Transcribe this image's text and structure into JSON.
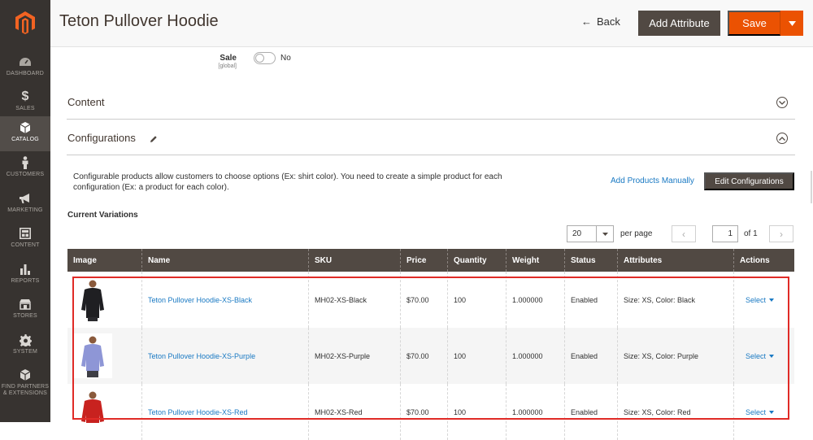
{
  "sidebar": {
    "items": [
      {
        "label": "DASHBOARD",
        "icon": "dashboard-icon"
      },
      {
        "label": "SALES",
        "icon": "dollar-icon"
      },
      {
        "label": "CATALOG",
        "icon": "cube-icon",
        "active": true
      },
      {
        "label": "CUSTOMERS",
        "icon": "person-icon"
      },
      {
        "label": "MARKETING",
        "icon": "megaphone-icon"
      },
      {
        "label": "CONTENT",
        "icon": "content-icon"
      },
      {
        "label": "REPORTS",
        "icon": "bar-chart-icon"
      },
      {
        "label": "STORES",
        "icon": "store-icon"
      },
      {
        "label": "SYSTEM",
        "icon": "gear-icon"
      },
      {
        "label": "FIND PARTNERS & EXTENSIONS",
        "icon": "partners-icon"
      }
    ]
  },
  "header": {
    "title": "Teton Pullover Hoodie",
    "back_label": "Back",
    "add_attribute_label": "Add Attribute",
    "save_label": "Save"
  },
  "sale_field": {
    "label": "Sale",
    "scope": "[global]",
    "value": "No"
  },
  "sections": {
    "content_title": "Content",
    "configurations_title": "Configurations"
  },
  "configurations": {
    "description": "Configurable products allow customers to choose options (Ex: shirt color). You need to create a simple product for each configuration (Ex: a product for each color).",
    "add_manually_label": "Add Products Manually",
    "edit_label": "Edit Configurations",
    "current_variations_label": "Current Variations"
  },
  "pager": {
    "per_page_value": "20",
    "per_page_label": "per page",
    "current_page": "1",
    "of_label": "of 1"
  },
  "table": {
    "columns": [
      "Image",
      "Name",
      "SKU",
      "Price",
      "Quantity",
      "Weight",
      "Status",
      "Attributes",
      "Actions"
    ],
    "rows": [
      {
        "name": "Teton Pullover Hoodie-XS-Black",
        "sku": "MH02-XS-Black",
        "price": "$70.00",
        "quantity": "100",
        "weight": "1.000000",
        "status": "Enabled",
        "attributes": "Size: XS, Color: Black",
        "action": "Select",
        "swatch": "#1f1f22"
      },
      {
        "name": "Teton Pullover Hoodie-XS-Purple",
        "sku": "MH02-XS-Purple",
        "price": "$70.00",
        "quantity": "100",
        "weight": "1.000000",
        "status": "Enabled",
        "attributes": "Size: XS, Color: Purple",
        "action": "Select",
        "swatch": "#8e96d6"
      },
      {
        "name": "Teton Pullover Hoodie-XS-Red",
        "sku": "MH02-XS-Red",
        "price": "$70.00",
        "quantity": "100",
        "weight": "1.000000",
        "status": "Enabled",
        "attributes": "Size: XS, Color: Red",
        "action": "Select",
        "swatch": "#c8221f"
      }
    ]
  },
  "colors": {
    "accent": "#eb5202",
    "dark_button": "#514943",
    "link": "#1979c3",
    "highlight": "#e02b27"
  }
}
